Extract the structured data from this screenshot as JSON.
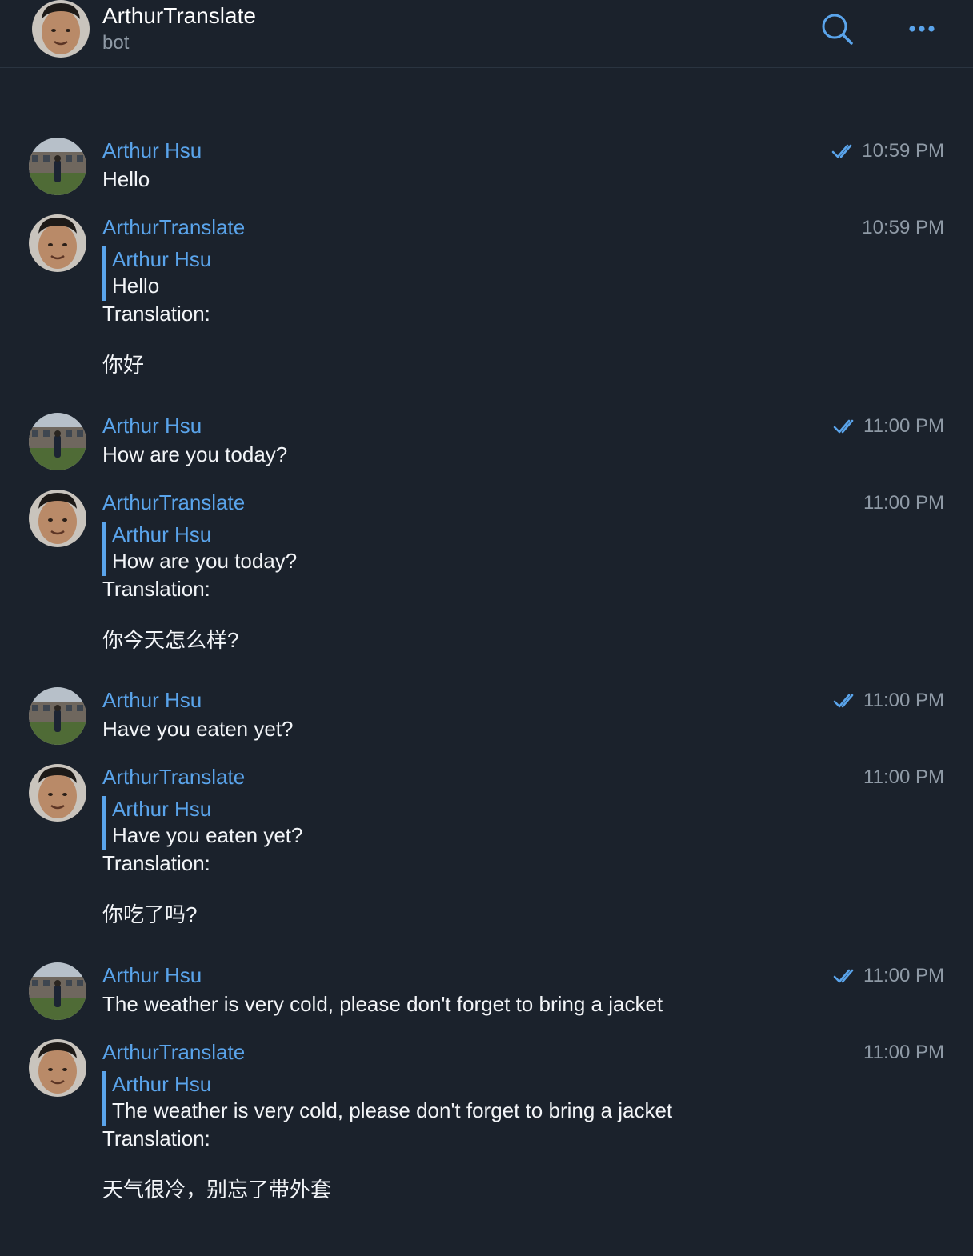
{
  "header": {
    "title": "ArthurTranslate",
    "subtitle": "bot",
    "search_icon": "search-icon",
    "more_icon": "more-options-icon"
  },
  "messages": [
    {
      "sender": "Arthur Hsu",
      "time": "10:59 PM",
      "read": true,
      "text": "Hello"
    },
    {
      "sender": "ArthurTranslate",
      "time": "10:59 PM",
      "reply_name": "Arthur Hsu",
      "reply_text": "Hello",
      "label": "Translation:",
      "translation": "你好"
    },
    {
      "sender": "Arthur Hsu",
      "time": "11:00 PM",
      "read": true,
      "text": "How are you today?"
    },
    {
      "sender": "ArthurTranslate",
      "time": "11:00 PM",
      "reply_name": "Arthur Hsu",
      "reply_text": "How are you today?",
      "label": "Translation:",
      "translation": "你今天怎么样?"
    },
    {
      "sender": "Arthur Hsu",
      "time": "11:00 PM",
      "read": true,
      "text": "Have you eaten yet?"
    },
    {
      "sender": "ArthurTranslate",
      "time": "11:00 PM",
      "reply_name": "Arthur Hsu",
      "reply_text": "Have you eaten yet?",
      "label": "Translation:",
      "translation": "你吃了吗?"
    },
    {
      "sender": "Arthur Hsu",
      "time": "11:00 PM",
      "read": true,
      "text": "The weather is very cold, please don't forget to bring a jacket"
    },
    {
      "sender": "ArthurTranslate",
      "time": "11:00 PM",
      "reply_name": "Arthur Hsu",
      "reply_text": "The weather is very cold, please don't forget to bring a jacket",
      "label": "Translation:",
      "translation": "天气很冷，别忘了带外套"
    }
  ],
  "colors": {
    "background": "#1b222c",
    "accent": "#5aa4eb",
    "muted": "#8f9aa6",
    "text": "#f2f4f7"
  }
}
